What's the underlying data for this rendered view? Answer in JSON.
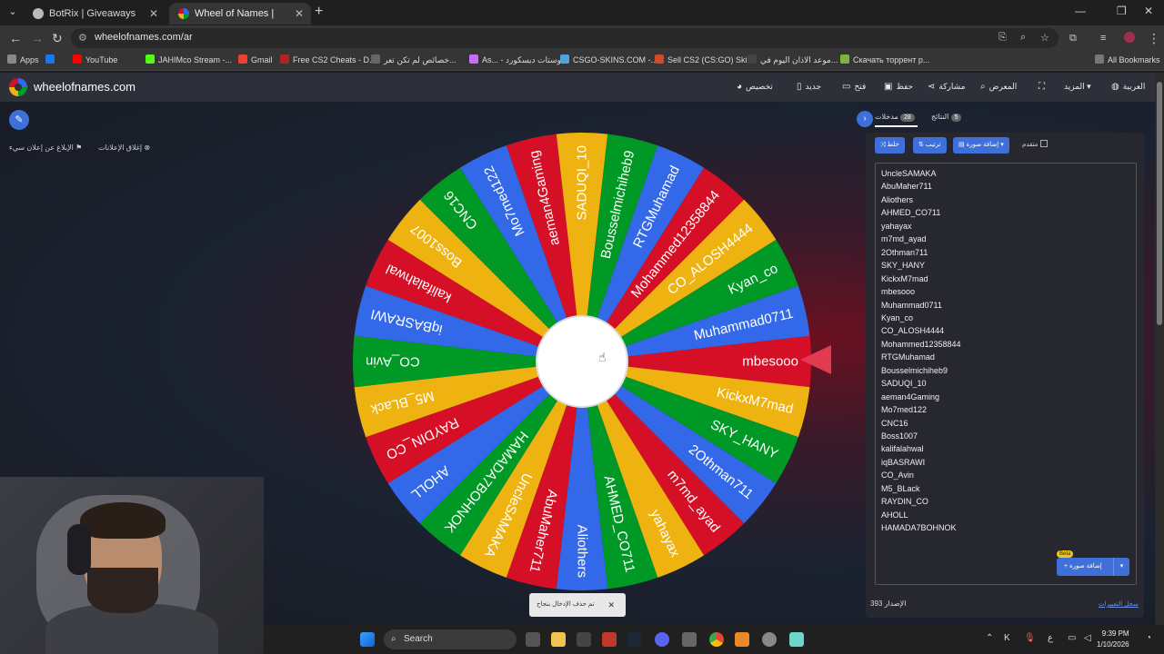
{
  "browser": {
    "tabs": [
      {
        "title": "BotRix | Giveaways",
        "active": false
      },
      {
        "title": "Wheel of Names | العشوائي",
        "active": true
      }
    ],
    "url": "wheelofnames.com/ar",
    "bookmarks": [
      {
        "label": "Apps",
        "color": "#888888"
      },
      {
        "label": "",
        "color": "#1877f2"
      },
      {
        "label": "YouTube",
        "color": "#ff0000"
      },
      {
        "label": "JAHIMco Stream -...",
        "color": "#53fc18"
      },
      {
        "label": "Gmail",
        "color": "#ea4335"
      },
      {
        "label": "Free CS2 Cheats - D...",
        "color": "#b22222"
      },
      {
        "label": "خصائص لم تكن تعر...",
        "color": "#666666"
      },
      {
        "label": "As... - بوستات ديسكورد",
        "color": "#c86bff"
      },
      {
        "label": "CSGO-SKINS.COM -...",
        "color": "#4fa3e0"
      },
      {
        "label": "Sell CS2 (CS:GO) Ski...",
        "color": "#d24a2c"
      },
      {
        "label": "موعد الاذان اليوم في...",
        "color": "#444444"
      },
      {
        "label": "Скачать торрент р...",
        "color": "#7cb342"
      },
      {
        "label": "All Bookmarks",
        "color": "#777777"
      }
    ]
  },
  "site": {
    "logo": "wheelofnames.com",
    "menu": [
      "تخصيص",
      "جديد",
      "فتح",
      "حفظ",
      "مشاركة",
      "المعرض",
      "",
      "المزيد",
      "العربية"
    ]
  },
  "ads": {
    "close_ads": "إغلاق الإعلانات",
    "report_ad": "الإبلاغ عن إعلان سيء"
  },
  "panel": {
    "entries_tab": "مدخلات",
    "entries_count": "28",
    "results_tab": "النتائج",
    "results_count": "5",
    "shuffle": "خلط",
    "sort": "ترتيب",
    "add_image": "إضافة صورة",
    "advanced": "متقدم",
    "add_image_bottom": "إضافة صورة",
    "beta": "Beta",
    "version_label": "الإصدار",
    "version": "393",
    "changelog": "سجل التغييرات"
  },
  "toast": "تم حذف الإدخال بنجاح",
  "wheel": {
    "colors": [
      "#d50f25",
      "#eeb211",
      "#009925",
      "#3369e8"
    ],
    "selected": "mbesooo",
    "segments": [
      "mbesooo",
      "KickxM7mad",
      "SKY_HANY",
      "2Othman711",
      "m7md_ayad",
      "yahayax",
      "AHMED_CO711",
      "Aliothers",
      "AbuMaher711",
      "UncleSAMAKA",
      "HAMADA7BOHNOK",
      "AHOLL",
      "RAYDIN_CO",
      "M5_BLack",
      "CO_Avin",
      "iqBASRAWI",
      "kalifalahwal",
      "Boss1007",
      "CNC16",
      "Mo7med122",
      "aeman4Gaming",
      "SADUQI_10",
      "Bousselmichiheb9",
      "RTGMuhamad",
      "Mohammed12358844",
      "CO_ALOSH4444",
      "Kyan_co",
      "Muhammad0711"
    ]
  },
  "entries": [
    "UncleSAMAKA",
    "AbuMaher711",
    "Aliothers",
    "AHMED_CO711",
    "yahayax",
    "m7md_ayad",
    "2Othman711",
    "SKY_HANY",
    "KickxM7mad",
    "mbesooo",
    "Muhammad0711",
    "Kyan_co",
    "CO_ALOSH4444",
    "Mohammed12358844",
    "RTGMuhamad",
    "Bousselmichiheb9",
    "SADUQI_10",
    "aeman4Gaming",
    "Mo7med122",
    "CNC16",
    "Boss1007",
    "kalifalahwal",
    "iqBASRAWI",
    "CO_Avin",
    "M5_BLack",
    "RAYDIN_CO",
    "AHOLL",
    "HAMADA7BOHNOK"
  ],
  "taskbar": {
    "search": "Search",
    "time": "9:39 PM",
    "date": "1/10/2026",
    "lang": "ع"
  }
}
